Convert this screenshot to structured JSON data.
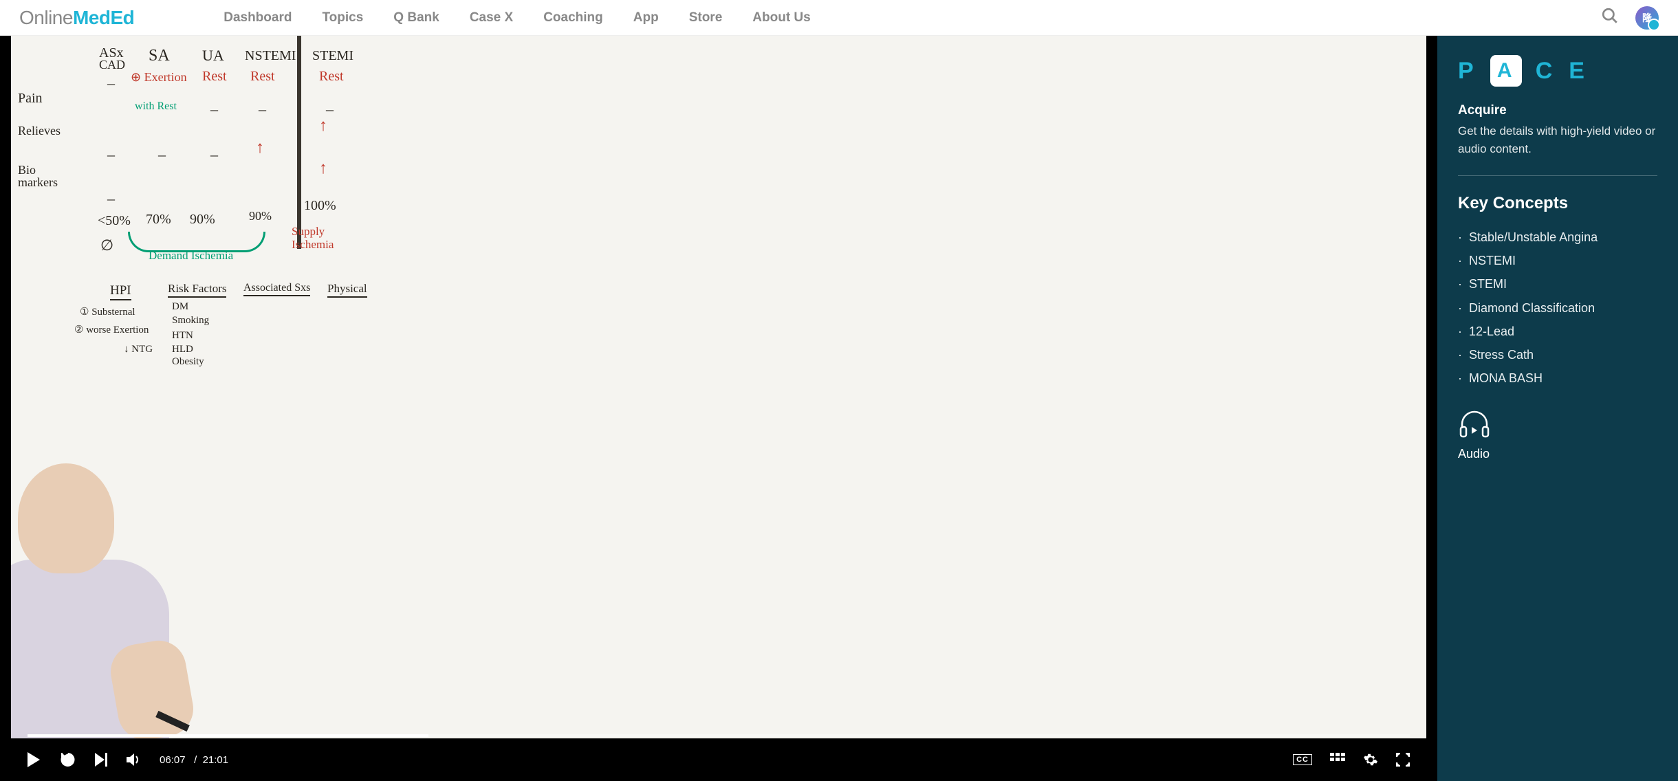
{
  "brand": {
    "pre": "Online",
    "mid": "Med",
    "post": "Ed"
  },
  "nav": {
    "items": [
      "Dashboard",
      "Topics",
      "Q Bank",
      "Case X",
      "Coaching",
      "App",
      "Store",
      "About Us"
    ]
  },
  "avatar_text": "隆",
  "video": {
    "current_time": "06:07",
    "separator": "/",
    "total_time": "21:01",
    "progress_percent": 29
  },
  "whiteboard": {
    "cols": [
      "ASx",
      "SA",
      "UA",
      "NSTEMI",
      "STEMI"
    ],
    "cad": "CAD",
    "rows": [
      "Pain",
      "Relieves",
      "Bio markers"
    ],
    "exertion": "⊕ Exertion",
    "rest": "Rest",
    "withrest": "with Rest",
    "percents": [
      "<50%",
      "70%",
      "90%",
      "90%",
      "100%"
    ],
    "nullsym": "∅",
    "demand": "Demand Ischemia",
    "supply": "Supply Ischemia",
    "hpi": {
      "title": "HPI",
      "items": [
        "① Substernal",
        "② worse Exertion",
        "↓ NTG"
      ]
    },
    "risk": {
      "title": "Risk Factors",
      "items": [
        "DM",
        "Smoking",
        "HTN",
        "HLD",
        "Obesity"
      ]
    },
    "assoc": "Associated Sxs",
    "phys": "Physical"
  },
  "sidebar": {
    "pace": [
      "P",
      "A",
      "C",
      "E"
    ],
    "acquire_title": "Acquire",
    "acquire_desc": "Get the details with high-yield video or audio content.",
    "kc_title": "Key Concepts",
    "concepts": [
      "Stable/Unstable Angina",
      "NSTEMI",
      "STEMI",
      "Diamond Classification",
      "12-Lead",
      "Stress Cath",
      "MONA BASH"
    ],
    "audio_label": "Audio"
  }
}
